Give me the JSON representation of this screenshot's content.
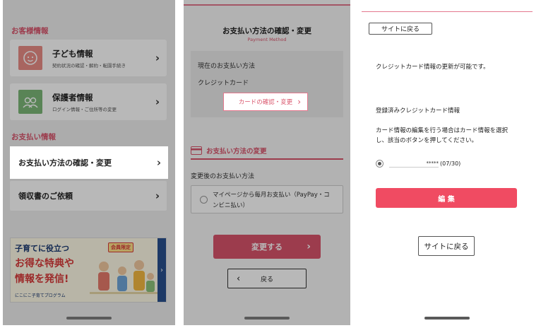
{
  "panel1": {
    "customer_section": "お客様情報",
    "child_card": {
      "title": "子ども情報",
      "sub": "契約状況の確認・解約・転園手続き"
    },
    "guardian_card": {
      "title": "保護者情報",
      "sub": "ログイン情報・ご住所等の変更"
    },
    "payment_section": "お支払い情報",
    "payment_method_row": "お支払い方法の確認・変更",
    "receipt_row": "領収書のご依頼",
    "chevron": "›",
    "banner": {
      "line1": "子育てに役立つ",
      "line2": "お得な特典や",
      "line3": "情報を発信!",
      "badge": "会員限定",
      "program": "にこにこ子育てプログラム",
      "arrow": "›"
    },
    "colors": {
      "accent": "#d9546b",
      "child_icon_bg": "#e98c86",
      "guardian_icon_bg": "#7cb878"
    }
  },
  "panel2": {
    "title": "お支払い方法の確認・変更",
    "subtitle": "Payment Method",
    "current_label": "現在のお支払い方法",
    "current_value": "クレジットカード",
    "card_change_button": "カードの確認・変更",
    "change_heading": "お支払い方法の変更",
    "after_label": "変更後のお支払い方法",
    "option_line1": "マイページから毎月お支払い（PayPay・コ",
    "option_line2": "ンビニ払い）",
    "submit_button": "変更する",
    "back_button": "戻る",
    "chevron_right": "›",
    "chevron_left": "‹"
  },
  "panel3": {
    "top_back_button": "サイトに戻る",
    "notice": "クレジットカード情報の更新が可能です。",
    "registered_label": "登録済みクレジットカード情報",
    "instruction_line1": "カード情報の編集を行う場合はカード情報を選択",
    "instruction_line2": "し、該当のボタンを押してください。",
    "card_masked": "*****",
    "card_expiry": "(07/30)",
    "edit_button": "編 集",
    "bottom_back_button": "サイトに戻る",
    "colors": {
      "edit_button": "#f04b62"
    }
  }
}
